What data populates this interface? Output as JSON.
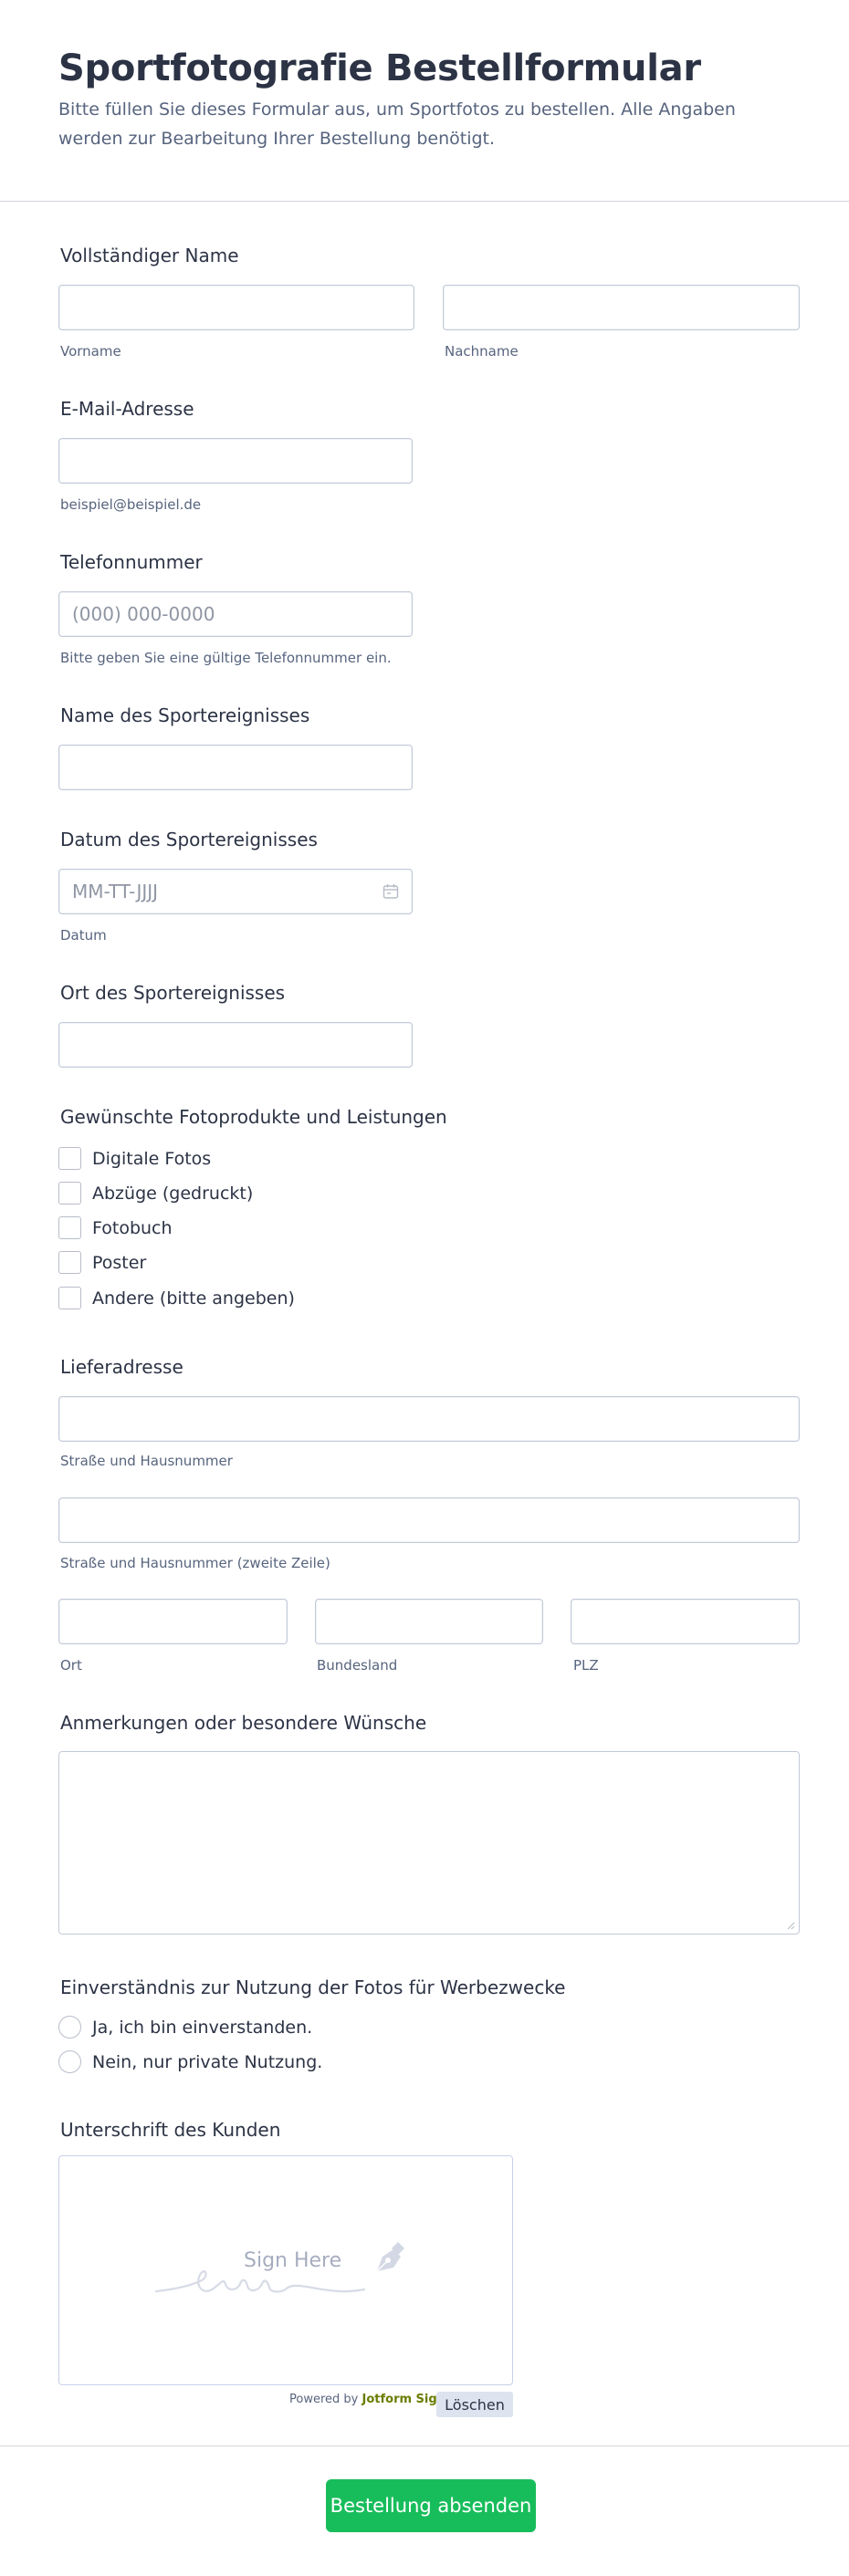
{
  "form": {
    "title": "Sportfotografie Bestellformular",
    "description": "Bitte füllen Sie dieses Formular aus, um Sportfotos zu bestellen. Alle Angaben werden zur Bearbeitung Ihrer Bestellung benötigt."
  },
  "name": {
    "label": "Vollständiger Name",
    "first_sublabel": "Vorname",
    "last_sublabel": "Nachname",
    "first_value": "",
    "last_value": ""
  },
  "email": {
    "label": "E-Mail-Adresse",
    "sublabel": "beispiel@beispiel.de",
    "value": ""
  },
  "phone": {
    "label": "Telefonnummer",
    "placeholder": "(000) 000-0000",
    "sublabel": "Bitte geben Sie eine gültige Telefonnummer ein."
  },
  "event_name": {
    "label": "Name des Sportereignisses",
    "value": ""
  },
  "event_date": {
    "label": "Datum des Sportereignisses",
    "placeholder": "MM-TT-JJJJ",
    "sublabel": "Datum",
    "icon": "calendar-icon"
  },
  "event_location": {
    "label": "Ort des Sportereignisses",
    "value": ""
  },
  "products": {
    "label": "Gewünschte Fotoprodukte und Leistungen",
    "options": [
      "Digitale Fotos",
      "Abzüge (gedruckt)",
      "Fotobuch",
      "Poster",
      "Andere (bitte angeben)"
    ]
  },
  "address": {
    "label": "Lieferadresse",
    "street_sublabel": "Straße und Hausnummer",
    "street2_sublabel": "Straße und Hausnummer (zweite Zeile)",
    "city_sublabel": "Ort",
    "state_sublabel": "Bundesland",
    "zip_sublabel": "PLZ"
  },
  "notes": {
    "label": "Anmerkungen oder besondere Wünsche",
    "value": ""
  },
  "consent": {
    "label": "Einverständnis zur Nutzung der Fotos für Werbezwecke",
    "options": [
      "Ja, ich bin einverstanden.",
      "Nein, nur private Nutzung."
    ]
  },
  "signature": {
    "label": "Unterschrift des Kunden",
    "prompt": "Sign Here",
    "powered_prefix": "Powered by",
    "powered_brand": "Jotform Sign",
    "clear_label": "Löschen",
    "icon": "pen-icon"
  },
  "submit": {
    "label": "Bestellung absenden"
  },
  "colors": {
    "text": "#2c3345",
    "muted": "#57647e",
    "border": "#c3cad8",
    "submit": "#18bd5b",
    "clear_button": "#dde3ef"
  }
}
